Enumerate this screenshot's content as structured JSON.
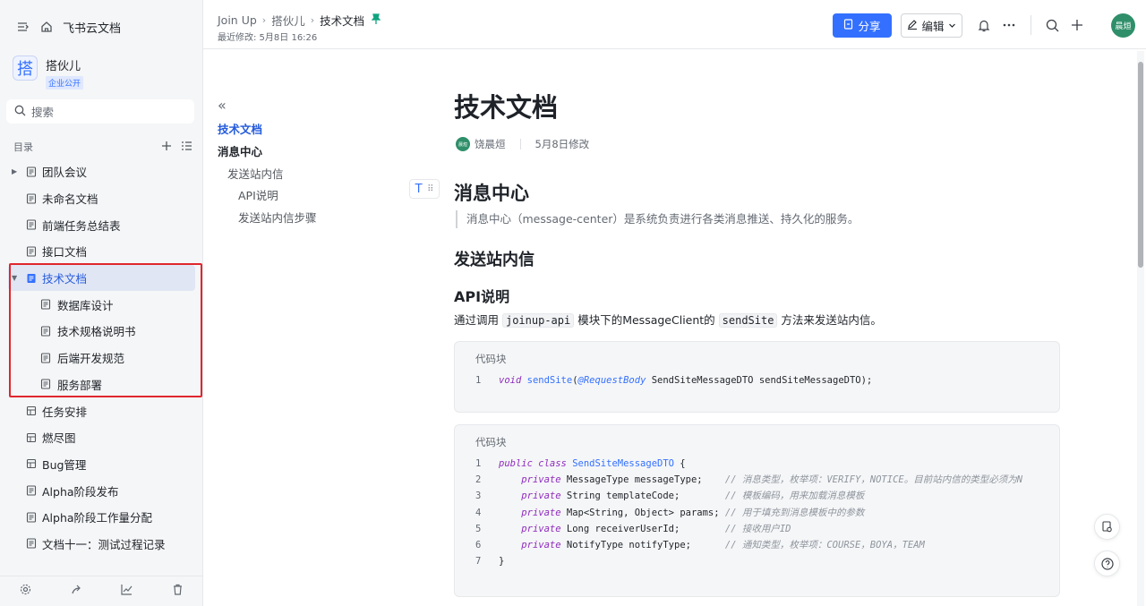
{
  "sidebar": {
    "home_label": "飞书云文档",
    "space": {
      "avatar_char": "搭",
      "name": "搭伙儿",
      "badge": "企业公开"
    },
    "search_placeholder": "搜索",
    "toc_label": "目录",
    "items": [
      {
        "label": "团队会议",
        "caret": "▶"
      },
      {
        "label": "未命名文档"
      },
      {
        "label": "前端任务总结表"
      },
      {
        "label": "接口文档"
      },
      {
        "label": "技术文档",
        "caret": "▼"
      },
      {
        "label": "数据库设计"
      },
      {
        "label": "技术规格说明书"
      },
      {
        "label": "后端开发规范"
      },
      {
        "label": "服务部署"
      },
      {
        "label": "任务安排"
      },
      {
        "label": "燃尽图"
      },
      {
        "label": "Bug管理"
      },
      {
        "label": "Alpha阶段发布"
      },
      {
        "label": "Alpha阶段工作量分配"
      },
      {
        "label": "文档十一：测试过程记录"
      }
    ]
  },
  "header": {
    "crumbs": [
      "Join Up",
      "搭伙儿",
      "技术文档"
    ],
    "modified": "最近修改: 5月8日 16:26",
    "share_label": "分享",
    "edit_label": "编辑",
    "user_avatar": "晨烜"
  },
  "outline": {
    "items": [
      "技术文档",
      "消息中心",
      "发送站内信",
      "API说明",
      "发送站内信步骤"
    ]
  },
  "doc": {
    "title": "技术文档",
    "author": "饶晨烜",
    "author_avatar": "晨烜",
    "modified": "5月8日修改",
    "h1": "消息中心",
    "quote": "消息中心（message-center）是系统负责进行各类消息推送、持久化的服务。",
    "h2": "发送站内信",
    "h3": "API说明",
    "para": {
      "pre": "通过调用 ",
      "code1": "joinup-api",
      "mid": " 模块下的MessageClient的 ",
      "code2": "sendSite",
      "post": " 方法来发送站内信。"
    },
    "code_label": "代码块",
    "code1": {
      "lines": [
        {
          "n": "1",
          "void": "void",
          "fn": "sendSite",
          "open": "(",
          "an": "@RequestBody",
          "rest": " SendSiteMessageDTO sendSiteMessageDTO);"
        }
      ]
    },
    "code2": {
      "lines": [
        {
          "n": "1",
          "kw": "public class",
          "cls": "SendSiteMessageDTO",
          "rest": " {"
        },
        {
          "n": "2",
          "kw": "private",
          "rest": " MessageType messageType;    ",
          "cm": "// 消息类型，枚举项：VERIFY，NOTICE。目前站内信的类型必须为N"
        },
        {
          "n": "3",
          "kw": "private",
          "rest": " String templateCode;        ",
          "cm": "// 模板编码，用来加载消息模板"
        },
        {
          "n": "4",
          "kw": "private",
          "rest": " Map<String, Object> params; ",
          "cm": "// 用于填充到消息模板中的参数"
        },
        {
          "n": "5",
          "kw": "private",
          "rest": " Long receiverUserId;        ",
          "cm": "// 接收用户ID"
        },
        {
          "n": "6",
          "kw": "private",
          "rest": " NotifyType notifyType;      ",
          "cm": "// 通知类型，枚举项：COURSE，BOYA，TEAM"
        },
        {
          "n": "7",
          "rest": "}"
        }
      ]
    }
  }
}
